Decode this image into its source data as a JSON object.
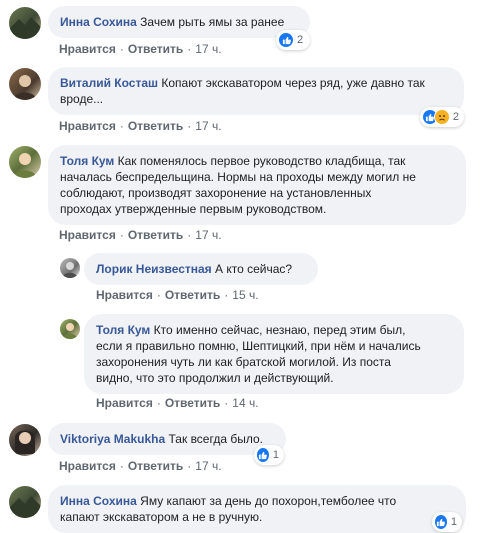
{
  "actions": {
    "like": "Нравится",
    "reply": "Ответить",
    "sep": "·"
  },
  "comments": [
    {
      "author": "Инна Сохина",
      "text": "Зачем рыть ямы за ранее",
      "time": "17 ч.",
      "reaction_count": "2"
    },
    {
      "author": "Виталий Косташ",
      "text": "Копают экскаватором через ряд, уже давно так",
      "text2": "вроде...",
      "time": "17 ч.",
      "reaction_count": "2"
    },
    {
      "author": "Толя Кум",
      "text": "Как поменялось первое руководство кладбища, так",
      "text2": "началась беспредельщина. Нормы на проходы между могил не",
      "text3": "соблюдают, производят захоронение на установленных",
      "text4": "проходах утвержденные первым руководством.",
      "time": "17 ч."
    },
    {
      "author": "Лорик Неизвестная",
      "text": "А кто сейчас?",
      "time": "15 ч."
    },
    {
      "author": "Толя Кум",
      "text": "Кто именно сейчас, незнаю, перед этим был,",
      "text2": "если я правильно помню, Шептицкий, при нём и начались",
      "text3": "захоронения чуть ли как братской могилой. Из поста",
      "text4": "видно, что это продолжил и действующий.",
      "time": "14 ч."
    },
    {
      "author": "Viktoriya Makukha",
      "text": "Так всегда было.",
      "time": "17 ч.",
      "reaction_count": "1"
    },
    {
      "author": "Инна Сохина",
      "text": "Яму капают за день до похорон,темболее что",
      "text2": "капают экскаватором а не в ручную.",
      "reaction_count": "1"
    }
  ],
  "colors": {
    "author": "#385898",
    "bubble": "#f0f2f5",
    "like": "#1877f2",
    "sad": "#f7b125"
  }
}
